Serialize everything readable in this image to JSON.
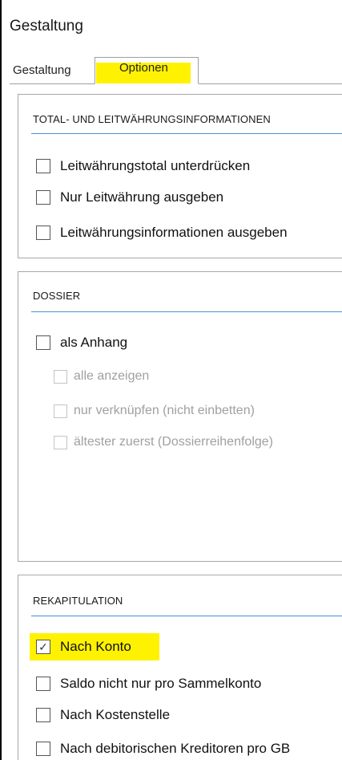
{
  "window": {
    "title": "Gestaltung"
  },
  "tabs": [
    {
      "label": "Gestaltung"
    },
    {
      "label": "Optionen",
      "active": true
    }
  ],
  "groups": {
    "total": {
      "title": "TOTAL- UND LEITWÄHRUNGSINFORMATIONEN",
      "options": [
        {
          "label": "Leitwährungstotal unterdrücken",
          "checked": false
        },
        {
          "label": "Nur Leitwährung ausgeben",
          "checked": false
        },
        {
          "label": "Leitwährungsinformationen ausgeben",
          "checked": false
        }
      ]
    },
    "dossier": {
      "title": "DOSSIER",
      "options": [
        {
          "label": "als Anhang",
          "checked": false
        },
        {
          "label": "alle anzeigen",
          "checked": false,
          "disabled": true
        },
        {
          "label": "nur verknüpfen (nicht einbetten)",
          "checked": false,
          "disabled": true
        },
        {
          "label": "ältester zuerst (Dossierreihenfolge)",
          "checked": false,
          "disabled": true
        }
      ]
    },
    "rekap": {
      "title": "REKAPITULATION",
      "options": [
        {
          "label": "Nach Konto",
          "checked": true,
          "check_glyph": "✓"
        },
        {
          "label": "Saldo nicht nur pro Sammelkonto",
          "checked": false
        },
        {
          "label": "Nach Kostenstelle",
          "checked": false
        },
        {
          "label": "Nach debitorischen Kreditoren pro GB",
          "checked": false
        }
      ]
    }
  },
  "colors": {
    "highlight": "#fff200",
    "rule": "#4a8fd6",
    "disabled_text": "#a0a0a0"
  }
}
